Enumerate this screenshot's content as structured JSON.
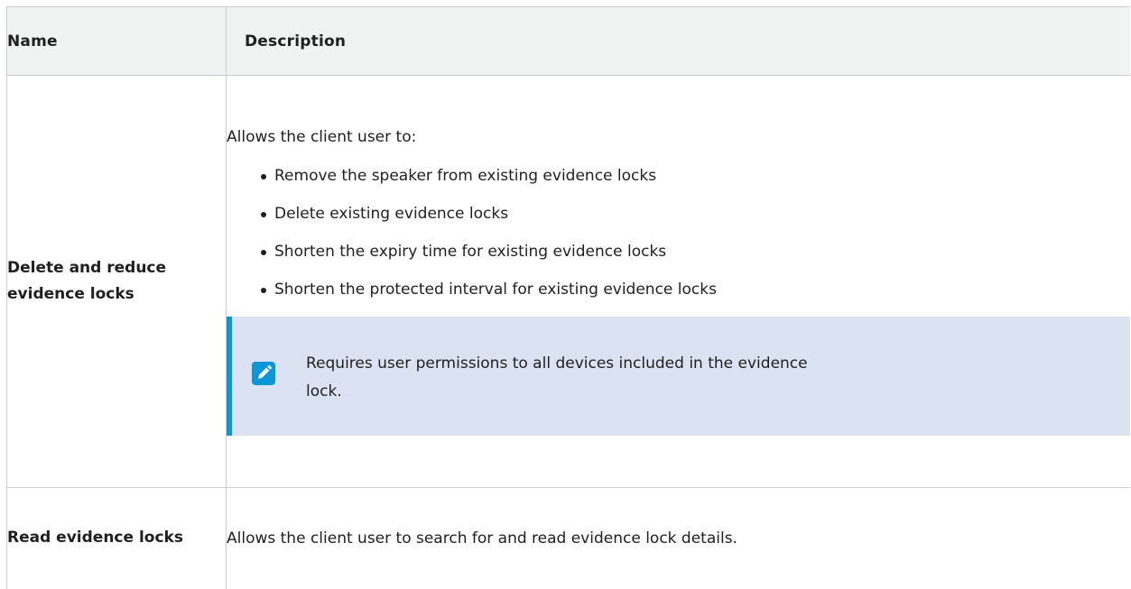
{
  "table": {
    "headers": {
      "name": "Name",
      "description": "Description"
    },
    "rows": [
      {
        "name": "Delete and reduce evidence locks",
        "intro": "Allows the client user to:",
        "bullets": [
          "Remove the speaker from existing evidence locks",
          "Delete existing evidence locks",
          "Shorten the expiry time for existing evidence locks",
          "Shorten the protected interval for existing evidence locks"
        ],
        "note": {
          "icon": "pencil-icon",
          "text": "Requires user permissions to all devices included in the evidence lock."
        }
      },
      {
        "name": "Read evidence locks",
        "description": "Allows the client user to search for and read evidence lock details."
      }
    ]
  },
  "colors": {
    "header_bg": "#f1f2f2",
    "border": "#c9cdd1",
    "note_bg": "#dbe3f2",
    "accent": "#0b97d6"
  }
}
